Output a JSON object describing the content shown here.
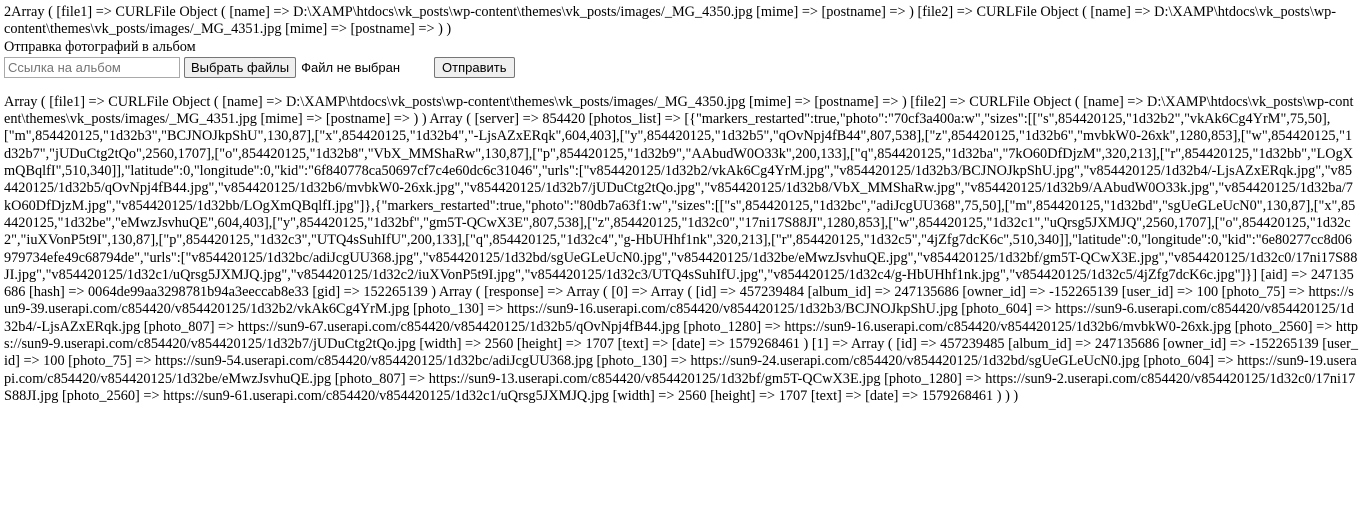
{
  "debug": {
    "top_dump": "2Array ( [file1] => CURLFile Object ( [name] => D:\\XAMP\\htdocs\\vk_posts\\wp-content\\themes\\vk_posts/images/_MG_4350.jpg [mime] => [postname] => ) [file2] => CURLFile Object ( [name] => D:\\XAMP\\htdocs\\vk_posts\\wp-content\\themes\\vk_posts/images/_MG_4351.jpg [mime] => [postname] => ) )",
    "bottom_dump": "Array ( [file1] => CURLFile Object ( [name] => D:\\XAMP\\htdocs\\vk_posts\\wp-content\\themes\\vk_posts/images/_MG_4350.jpg [mime] => [postname] => ) [file2] => CURLFile Object ( [name] => D:\\XAMP\\htdocs\\vk_posts\\wp-content\\themes\\vk_posts/images/_MG_4351.jpg [mime] => [postname] => ) ) Array ( [server] => 854420 [photos_list] => [{\"markers_restarted\":true,\"photo\":\"70cf3a400a:w\",\"sizes\":[[\"s\",854420125,\"1d32b2\",\"vkAk6Cg4YrM\",75,50],[\"m\",854420125,\"1d32b3\",\"BCJNOJkpShU\",130,87],[\"x\",854420125,\"1d32b4\",\"-LjsAZxERqk\",604,403],[\"y\",854420125,\"1d32b5\",\"qOvNpj4fB44\",807,538],[\"z\",854420125,\"1d32b6\",\"mvbkW0-26xk\",1280,853],[\"w\",854420125,\"1d32b7\",\"jUDuCtg2tQo\",2560,1707],[\"o\",854420125,\"1d32b8\",\"VbX_MMShaRw\",130,87],[\"p\",854420125,\"1d32b9\",\"AAbudW0O33k\",200,133],[\"q\",854420125,\"1d32ba\",\"7kO60DfDjzM\",320,213],[\"r\",854420125,\"1d32bb\",\"LOgXmQBqlfI\",510,340]],\"latitude\":0,\"longitude\":0,\"kid\":\"6f840778ca50697cf7c4e60dc6c31046\",\"urls\":[\"v854420125/1d32b2/vkAk6Cg4YrM.jpg\",\"v854420125/1d32b3/BCJNOJkpShU.jpg\",\"v854420125/1d32b4/-LjsAZxERqk.jpg\",\"v854420125/1d32b5/qOvNpj4fB44.jpg\",\"v854420125/1d32b6/mvbkW0-26xk.jpg\",\"v854420125/1d32b7/jUDuCtg2tQo.jpg\",\"v854420125/1d32b8/VbX_MMShaRw.jpg\",\"v854420125/1d32b9/AAbudW0O33k.jpg\",\"v854420125/1d32ba/7kO60DfDjzM.jpg\",\"v854420125/1d32bb/LOgXmQBqlfI.jpg\"]},{\"markers_restarted\":true,\"photo\":\"80db7a63f1:w\",\"sizes\":[[\"s\",854420125,\"1d32bc\",\"adiJcgUU368\",75,50],[\"m\",854420125,\"1d32bd\",\"sgUeGLeUcN0\",130,87],[\"x\",854420125,\"1d32be\",\"eMwzJsvhuQE\",604,403],[\"y\",854420125,\"1d32bf\",\"gm5T-QCwX3E\",807,538],[\"z\",854420125,\"1d32c0\",\"17ni17S88JI\",1280,853],[\"w\",854420125,\"1d32c1\",\"uQrsg5JXMJQ\",2560,1707],[\"o\",854420125,\"1d32c2\",\"iuXVonP5t9I\",130,87],[\"p\",854420125,\"1d32c3\",\"UTQ4sSuhIfU\",200,133],[\"q\",854420125,\"1d32c4\",\"g-HbUHhf1nk\",320,213],[\"r\",854420125,\"1d32c5\",\"4jZfg7dcK6c\",510,340]],\"latitude\":0,\"longitude\":0,\"kid\":\"6e80277cc8d06979734efe49c68794de\",\"urls\":[\"v854420125/1d32bc/adiJcgUU368.jpg\",\"v854420125/1d32bd/sgUeGLeUcN0.jpg\",\"v854420125/1d32be/eMwzJsvhuQE.jpg\",\"v854420125/1d32bf/gm5T-QCwX3E.jpg\",\"v854420125/1d32c0/17ni17S88JI.jpg\",\"v854420125/1d32c1/uQrsg5JXMJQ.jpg\",\"v854420125/1d32c2/iuXVonP5t9I.jpg\",\"v854420125/1d32c3/UTQ4sSuhIfU.jpg\",\"v854420125/1d32c4/g-HbUHhf1nk.jpg\",\"v854420125/1d32c5/4jZfg7dcK6c.jpg\"]}] [aid] => 247135686 [hash] => 0064de99aa3298781b94a3eeccab8e33 [gid] => 152265139 ) Array ( [response] => Array ( [0] => Array ( [id] => 457239484 [album_id] => 247135686 [owner_id] => -152265139 [user_id] => 100 [photo_75] => https://sun9-39.userapi.com/c854420/v854420125/1d32b2/vkAk6Cg4YrM.jpg [photo_130] => https://sun9-16.userapi.com/c854420/v854420125/1d32b3/BCJNOJkpShU.jpg [photo_604] => https://sun9-6.userapi.com/c854420/v854420125/1d32b4/-LjsAZxERqk.jpg [photo_807] => https://sun9-67.userapi.com/c854420/v854420125/1d32b5/qOvNpj4fB44.jpg [photo_1280] => https://sun9-16.userapi.com/c854420/v854420125/1d32b6/mvbkW0-26xk.jpg [photo_2560] => https://sun9-9.userapi.com/c854420/v854420125/1d32b7/jUDuCtg2tQo.jpg [width] => 2560 [height] => 1707 [text] => [date] => 1579268461 ) [1] => Array ( [id] => 457239485 [album_id] => 247135686 [owner_id] => -152265139 [user_id] => 100 [photo_75] => https://sun9-54.userapi.com/c854420/v854420125/1d32bc/adiJcgUU368.jpg [photo_130] => https://sun9-24.userapi.com/c854420/v854420125/1d32bd/sgUeGLeUcN0.jpg [photo_604] => https://sun9-19.userapi.com/c854420/v854420125/1d32be/eMwzJsvhuQE.jpg [photo_807] => https://sun9-13.userapi.com/c854420/v854420125/1d32bf/gm5T-QCwX3E.jpg [photo_1280] => https://sun9-2.userapi.com/c854420/v854420125/1d32c0/17ni17S88JI.jpg [photo_2560] => https://sun9-61.userapi.com/c854420/v854420125/1d32c1/uQrsg5JXMJQ.jpg [width] => 2560 [height] => 1707 [text] => [date] => 1579268461 ) ) )"
  },
  "form": {
    "title": "Отправка фотографий в альбом",
    "album_input": {
      "value": "",
      "placeholder": "Ссылка на альбом"
    },
    "file_button_label": "Выбрать файлы",
    "file_status": "Файл не выбран",
    "submit_label": "Отправить"
  }
}
